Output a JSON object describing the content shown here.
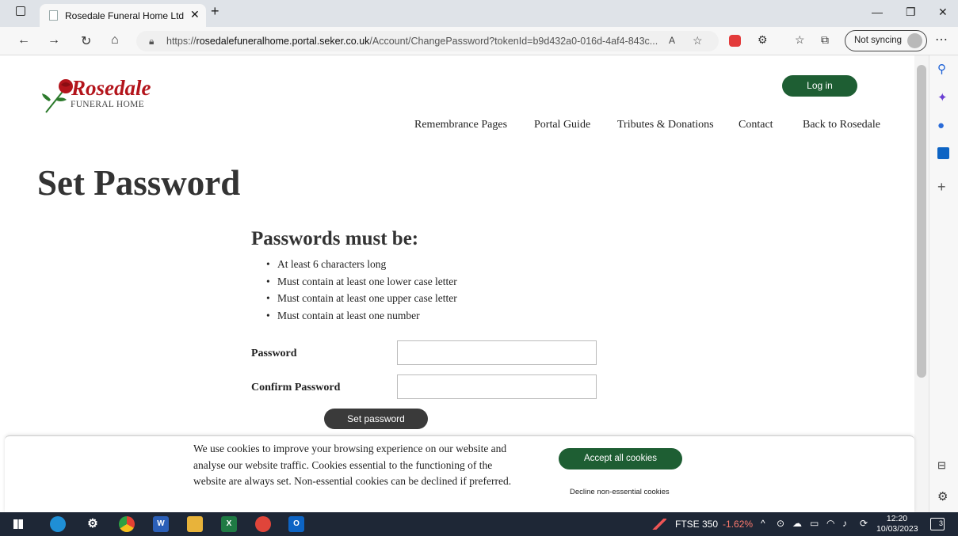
{
  "browser": {
    "tab_title": "Rosedale Funeral Home Ltd Clien",
    "url_prefix": "https://",
    "url_host": "rosedalefuneralhome.portal.seker.co.uk",
    "url_path": "/Account/ChangePassword?tokenId=b9d432a0-016d-4af4-843c...",
    "sync_label": "Not syncing"
  },
  "site": {
    "logo_word": "Rosedale",
    "logo_sub": "FUNERAL HOME",
    "login_label": "Log in",
    "nav": [
      "Remembrance Pages",
      "Portal Guide",
      "Tributes & Donations",
      "Contact",
      "Back to Rosedale"
    ]
  },
  "page": {
    "title": "Set Password",
    "requirements_title": "Passwords must be:",
    "requirements": [
      "At least 6 characters long",
      "Must contain at least one lower case letter",
      "Must contain at least one upper case letter",
      "Must contain at least one number"
    ],
    "password_label": "Password",
    "confirm_label": "Confirm Password",
    "password_value": "",
    "confirm_value": "",
    "submit_label": "Set password"
  },
  "cookies": {
    "text": "We use cookies to improve your browsing experience on our website and analyse our website traffic. Cookies essential to the functioning of the website are always set. Non-essential cookies can be declined if preferred.",
    "accept_label": "Accept all cookies",
    "decline_label": "Decline non-essential cookies"
  },
  "taskbar": {
    "ticker_name": "FTSE 350",
    "ticker_change": "-1.62%",
    "time": "12:20",
    "date": "10/03/2023",
    "notification_count": "3"
  },
  "colors": {
    "brand_red": "#b3141b",
    "brand_green": "#1e5e33",
    "taskbar": "#1e2736"
  }
}
